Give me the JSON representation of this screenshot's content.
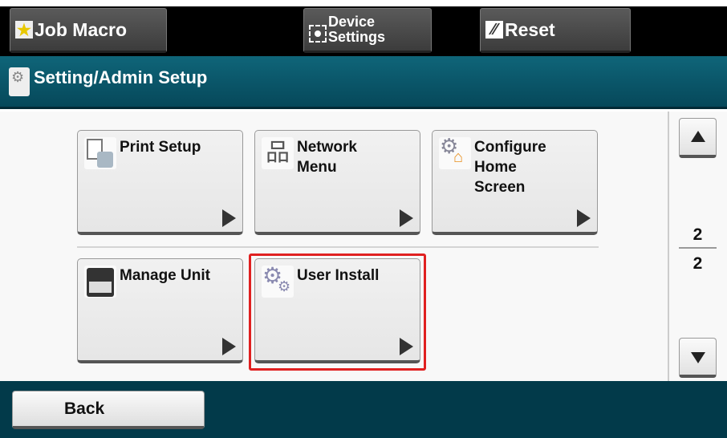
{
  "topbar": {
    "job_macro": "Job Macro",
    "device_settings_line1": "Device",
    "device_settings_line2": "Settings",
    "reset": "Reset"
  },
  "header": {
    "title": "Setting/Admin Setup"
  },
  "tiles": [
    {
      "label": "Print Setup",
      "icon": "print-setup-icon"
    },
    {
      "label": "Network\nMenu",
      "icon": "network-icon"
    },
    {
      "label": "Configure\nHome\nScreen",
      "icon": "configure-home-icon"
    },
    {
      "label": "Manage Unit",
      "icon": "printer-icon"
    },
    {
      "label": "User Install",
      "icon": "gears-icon",
      "selected": true
    }
  ],
  "pager": {
    "current": "2",
    "total": "2"
  },
  "footer": {
    "back": "Back"
  },
  "colors": {
    "header": "#0b5a6d",
    "footer": "#023a4a",
    "selection": "#e02020"
  }
}
